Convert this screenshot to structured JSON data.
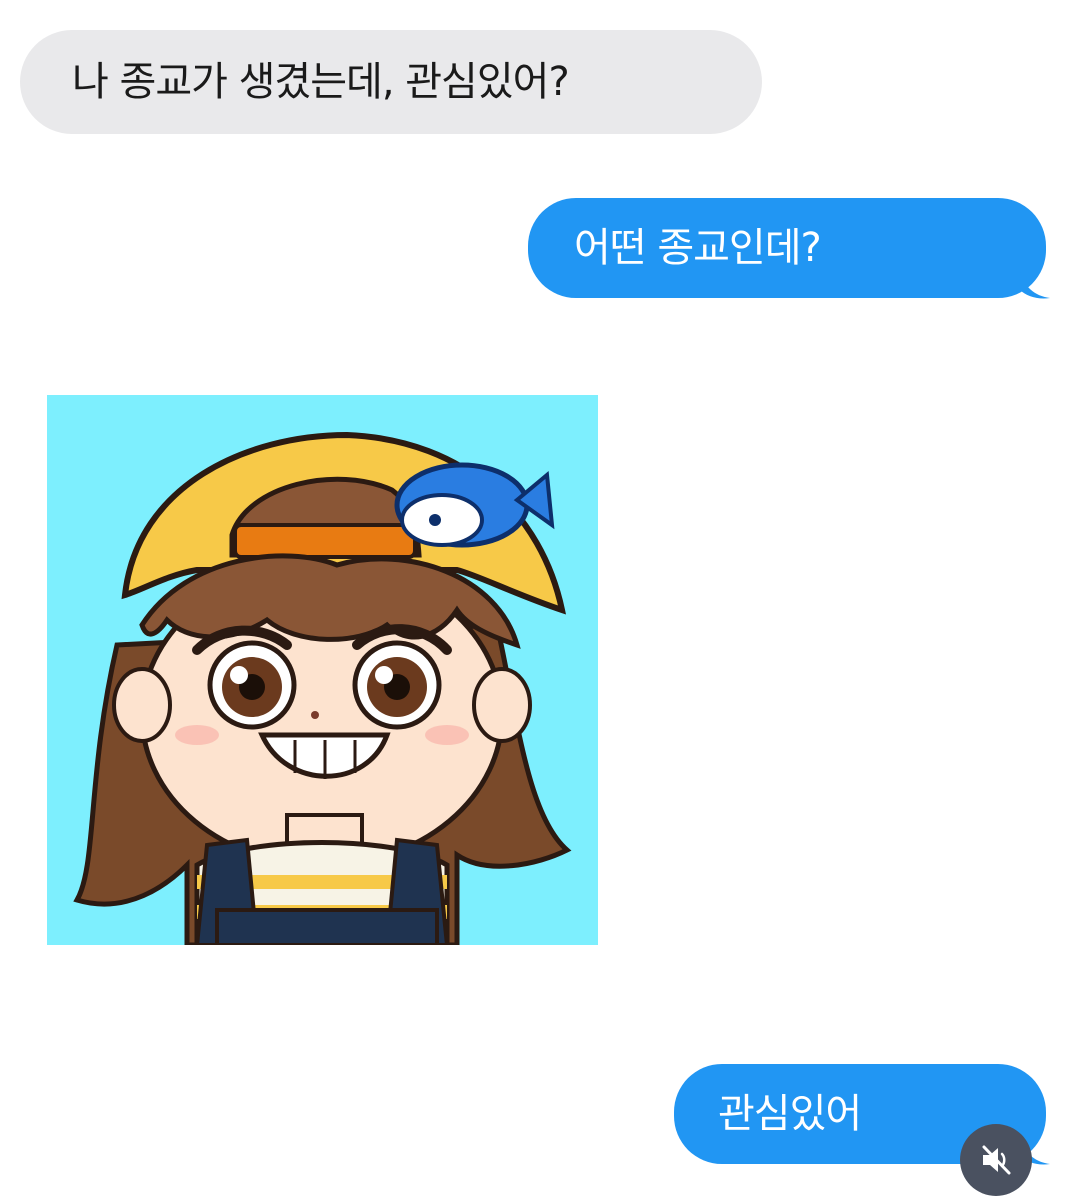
{
  "messages": [
    {
      "direction": "incoming",
      "text": "나 종교가 생겼는데, 관심있어?"
    },
    {
      "direction": "outgoing",
      "text": "어떤 종교인데?"
    },
    {
      "direction": "incoming",
      "type": "image",
      "content": "cartoon-girl-avatar-image"
    },
    {
      "direction": "outgoing",
      "text": "관심있어"
    }
  ],
  "colors": {
    "incoming_bubble": "#e9e9eb",
    "outgoing_bubble": "#2196f3",
    "image_background": "#7deffe",
    "mute_button": "#4a5160"
  },
  "controls": {
    "mute_icon": "speaker-muted-icon"
  }
}
